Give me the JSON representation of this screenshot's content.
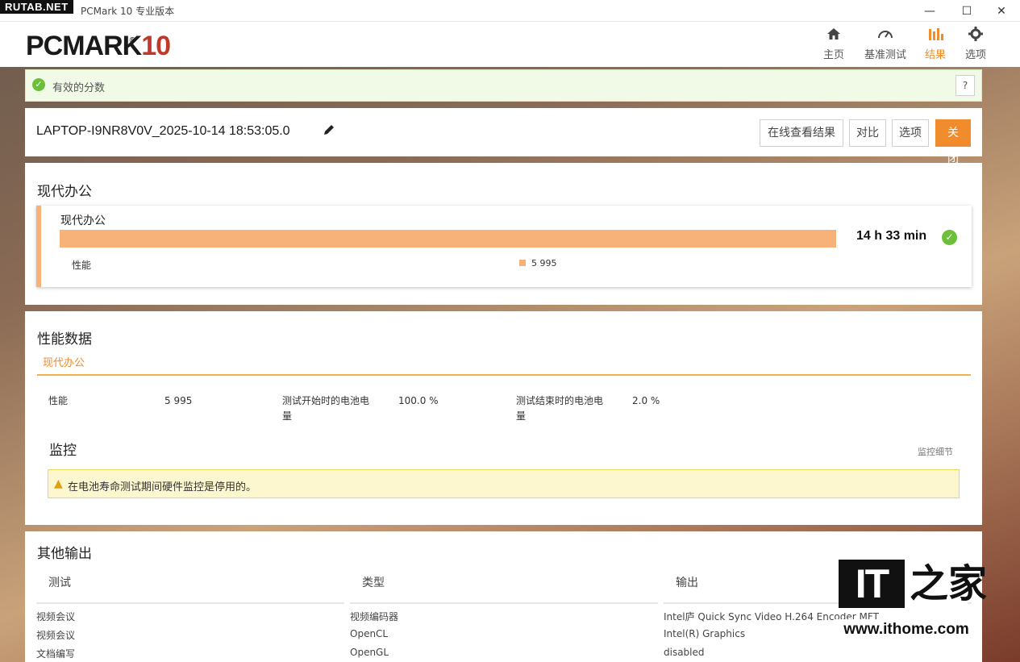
{
  "watermark": {
    "tag": "RUTAB.NET",
    "ithome_logo": "IT",
    "ithome_cn": "之家",
    "ithome_url": "www.ithome.com"
  },
  "window": {
    "title": "PCMark 10 专业版本",
    "controls": [
      "—",
      "☐",
      "✕"
    ]
  },
  "app": {
    "logo_main": "PCMARK",
    "logo_num": "10",
    "logo_reg": "®",
    "nav": [
      {
        "label": "主页",
        "icon": "home-icon",
        "glyph": "⌂"
      },
      {
        "label": "基准测试",
        "icon": "gauge-icon",
        "glyph": "◔"
      },
      {
        "label": "结果",
        "icon": "bar-chart-icon",
        "glyph": "▮▮"
      },
      {
        "label": "选项",
        "icon": "gear-icon",
        "glyph": "⚙"
      }
    ],
    "active_nav": "结果",
    "accent_color": "#f08c2c"
  },
  "valid": {
    "text": "有效的分数",
    "help": "?"
  },
  "result": {
    "name": "LAPTOP-I9NR8V0V_2025-10-14 18:53:05.0",
    "buttons": {
      "online": "在线查看结果",
      "compare": "对比",
      "options": "选项",
      "close": "关闭"
    }
  },
  "office": {
    "section_title": "现代办公",
    "card_title": "现代办公",
    "perf_label": "性能",
    "perf_value": "5 995",
    "battery_life": "14 h 33 min",
    "bar_color": "#f7b27a"
  },
  "perf_data": {
    "section_title": "性能数据",
    "tab": "现代办公",
    "rows": [
      {
        "label": "性能",
        "value": "5 995"
      },
      {
        "label": "测试开始时的电池电量",
        "value": "100.0 %"
      },
      {
        "label": "测试结束时的电池电量",
        "value": "2.0 %"
      }
    ],
    "monitor_title": "监控",
    "monitor_link": "监控细节",
    "warning": "在电池寿命测试期间硬件监控是停用的。"
  },
  "other_output": {
    "section_title": "其他输出",
    "headers": [
      "测试",
      "类型",
      "输出"
    ],
    "rows": [
      [
        "视频会议",
        "视频编码器",
        "Intel庐 Quick Sync Video H.264 Encoder MFT"
      ],
      [
        "视频会议",
        "OpenCL",
        "Intel(R) Graphics"
      ],
      [
        "文档编写",
        "OpenGL",
        "disabled"
      ]
    ]
  }
}
